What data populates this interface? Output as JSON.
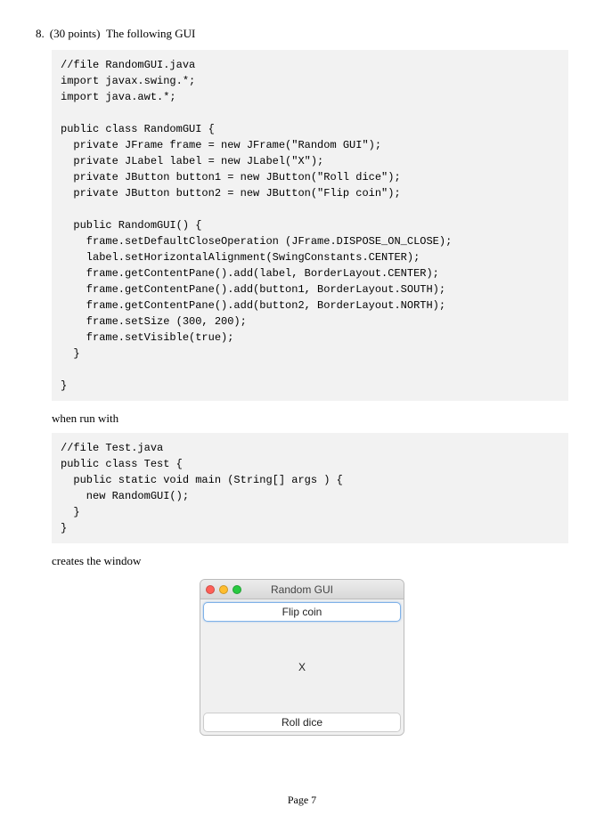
{
  "question": {
    "number": "8.",
    "points": "(30 points)",
    "intro": "The following GUI"
  },
  "code1": "//file RandomGUI.java\nimport javax.swing.*;\nimport java.awt.*;\n\npublic class RandomGUI {\n  private JFrame frame = new JFrame(\"Random GUI\");\n  private JLabel label = new JLabel(\"X\");\n  private JButton button1 = new JButton(\"Roll dice\");\n  private JButton button2 = new JButton(\"Flip coin\");\n\n  public RandomGUI() {\n    frame.setDefaultCloseOperation (JFrame.DISPOSE_ON_CLOSE);\n    label.setHorizontalAlignment(SwingConstants.CENTER);\n    frame.getContentPane().add(label, BorderLayout.CENTER);\n    frame.getContentPane().add(button1, BorderLayout.SOUTH);\n    frame.getContentPane().add(button2, BorderLayout.NORTH);\n    frame.setSize (300, 200);\n    frame.setVisible(true);\n  }\n\n}",
  "narrative1": "when run with",
  "code2": "//file Test.java\npublic class Test {\n  public static void main (String[] args ) {\n    new RandomGUI();\n  }\n}",
  "narrative2": "creates the window",
  "window": {
    "title": "Random GUI",
    "north_button": "Flip coin",
    "center_label": "X",
    "south_button": "Roll dice"
  },
  "footer": "Page 7"
}
